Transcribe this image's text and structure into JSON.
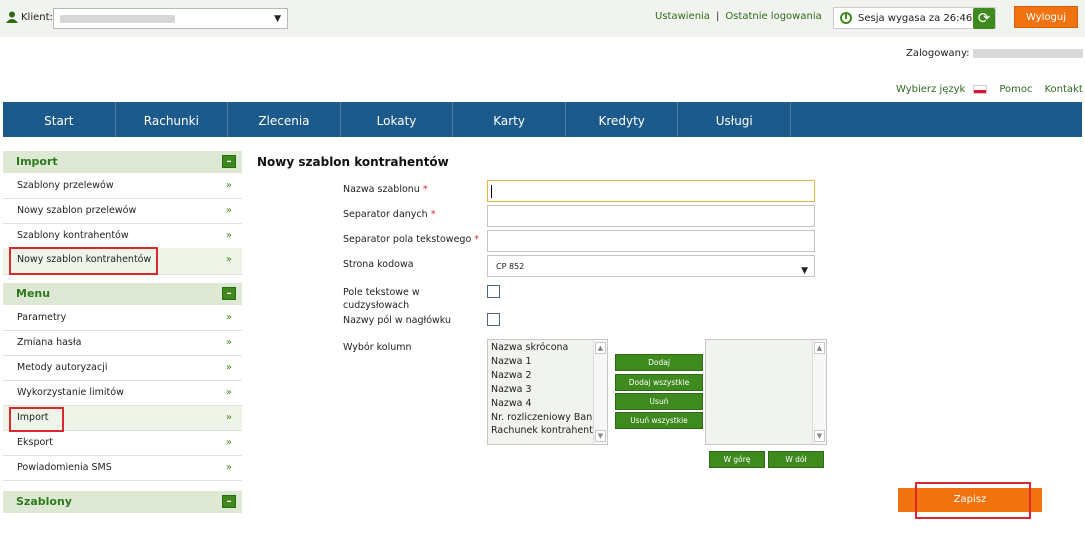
{
  "header": {
    "client_label": "Klient:",
    "links": [
      "Ustawienia",
      "Ostatnie logowania"
    ],
    "separator": "|",
    "session_text": "Sesja wygasa za 26:46",
    "logout_label": "Wyloguj",
    "logged_in_label": "Zalogowany:",
    "language_label": "Wybierz język",
    "help_label": "Pomoc",
    "contact_label": "Kontakt"
  },
  "nav": [
    "Start",
    "Rachunki",
    "Zlecenia",
    "Lokaty",
    "Karty",
    "Kredyty",
    "Usługi"
  ],
  "sidebar": {
    "import_title": "Import",
    "import_items": [
      "Szablony przelewów",
      "Nowy szablon przelewów",
      "Szablony kontrahentów",
      "Nowy szablon kontrahentów"
    ],
    "menu_title": "Menu",
    "menu_items": [
      "Parametry",
      "Zmiana hasła",
      "Metody autoryzacji",
      "Wykorzystanie limitów",
      "Import",
      "Eksport",
      "Powiadomienia SMS"
    ],
    "templates_title": "Szablony",
    "collapse_symbol": "–",
    "arrow": "»"
  },
  "form": {
    "title": "Nowy szablon kontrahentów",
    "template_name_label": "Nazwa szablonu",
    "data_separator_label": "Separator danych",
    "text_separator_label": "Separator pola tekstowego",
    "codepage_label": "Strona kodowa",
    "codepage_value": "CP 852",
    "quoted_text_label_1": "Pole tekstowe w",
    "quoted_text_label_2": "cudzysłowach",
    "header_names_label": "Nazwy pól w nagłówku",
    "columns_label": "Wybór kolumn",
    "required_mark": "*",
    "available_columns": [
      "Nazwa skrócona",
      "Nazwa 1",
      "Nazwa 2",
      "Nazwa 3",
      "Nazwa 4",
      "Nr. rozliczeniowy Banku",
      "Rachunek kontrahenta"
    ],
    "btn_add": "Dodaj",
    "btn_add_all": "Dodaj wszystkie",
    "btn_remove": "Usuń",
    "btn_remove_all": "Usuń wszystkie",
    "btn_up": "W górę",
    "btn_down": "W dół",
    "save_label": "Zapisz"
  }
}
